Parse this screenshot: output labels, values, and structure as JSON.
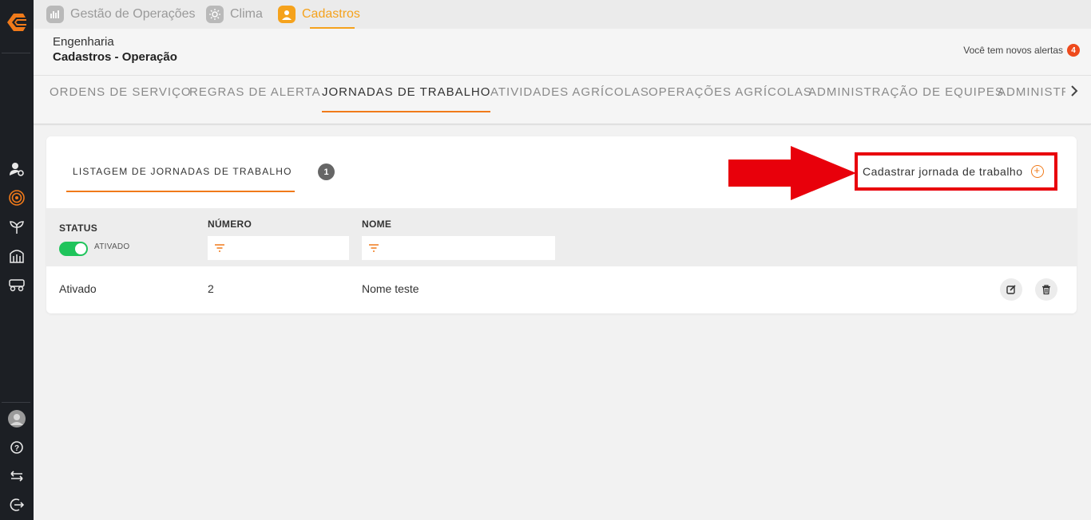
{
  "app_tabs": [
    {
      "label": "Gestão de Operações",
      "icon": "chart-icon"
    },
    {
      "label": "Clima",
      "icon": "sun-icon"
    },
    {
      "label": "Cadastros",
      "icon": "user-icon",
      "active": true
    }
  ],
  "header": {
    "breadcrumb_parent": "Engenharia",
    "breadcrumb_title": "Cadastros - Operação",
    "alerts_text": "Você tem novos alertas",
    "alerts_count": "4"
  },
  "sub_tabs": [
    {
      "label": "ORDENS DE SERVIÇO"
    },
    {
      "label": "REGRAS DE ALERTA"
    },
    {
      "label": "JORNADAS DE TRABALHO",
      "active": true
    },
    {
      "label": "ATIVIDADES AGRÍCOLAS"
    },
    {
      "label": "OPERAÇÕES AGRÍCOLAS"
    },
    {
      "label": "ADMINISTRAÇÃO DE EQUIPES"
    },
    {
      "label": "ADMINISTR"
    }
  ],
  "card": {
    "list_tab_label": "LISTAGEM DE JORNADAS DE TRABALHO",
    "count": "1",
    "create_button_label": "Cadastrar jornada de trabalho",
    "columns": {
      "status": "STATUS",
      "status_toggle_label": "ATIVADO",
      "number": "NÚMERO",
      "name": "NOME"
    },
    "rows": [
      {
        "status": "Ativado",
        "number": "2",
        "name": "Nome teste"
      }
    ]
  },
  "colors": {
    "accent": "#f07a1a",
    "app_tab_active": "#f5a21c",
    "annotation_red": "#e8000b",
    "toggle_on": "#1fc45b",
    "sidebar_bg": "#1c1f24"
  }
}
